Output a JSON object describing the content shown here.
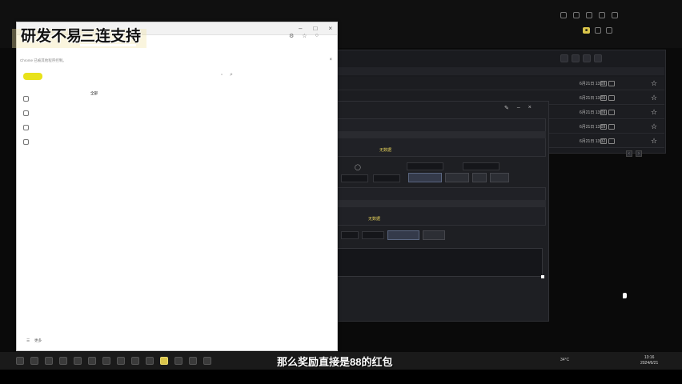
{
  "overlay": {
    "brand_a": "研发不易",
    "brand_b": "三连支持"
  },
  "subtitle": "那么奖励直接是88的红包",
  "browser": {
    "title": "",
    "notice": "Chrome 已被其他程序控制。",
    "logo": "",
    "search_value": "",
    "right_links": [
      "",
      "",
      ""
    ],
    "sidebar": [
      {
        "label": ""
      },
      {
        "label": ""
      },
      {
        "label": ""
      },
      {
        "label": ""
      }
    ],
    "sidebar_badge": "",
    "tabs": [
      "全部",
      "",
      "",
      ""
    ],
    "sort_label": "",
    "filters": [
      "",
      "",
      "",
      "",
      "",
      "",
      "",
      "",
      "",
      ""
    ],
    "bottom_more": "更多"
  },
  "bg_app": {
    "toolbar": [
      "",
      "",
      "",
      ""
    ],
    "rows": [
      {
        "date": "6月21日 13:09",
        "status": "",
        "code": ""
      },
      {
        "date": "6月21日 13:09",
        "status": "",
        "code": ""
      },
      {
        "date": "6月21日 13:09",
        "status": "",
        "code": ""
      },
      {
        "date": "6月21日 13:09",
        "status": "",
        "code": ""
      },
      {
        "date": "6月21日 13:32",
        "status": "",
        "code": ""
      }
    ]
  },
  "dialog": {
    "headers1": [
      "",
      "",
      "",
      "",
      "",
      "",
      ""
    ],
    "no_data_1": "无数据",
    "no_data_2": "无数据",
    "btn_row1": [
      "",
      "",
      "",
      ""
    ],
    "btn_row2": [
      "",
      "",
      ""
    ],
    "long_label": ""
  },
  "taskbar": {
    "weather": "34°C",
    "time": "13:16",
    "date": "2024/6/21"
  }
}
